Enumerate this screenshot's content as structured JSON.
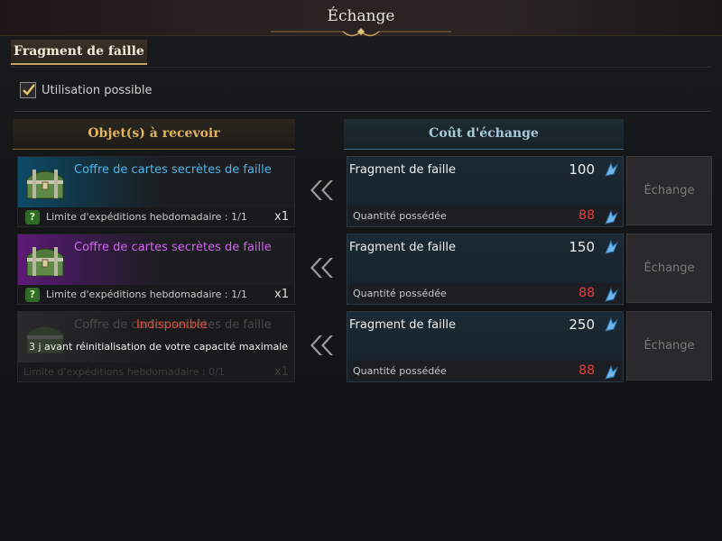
{
  "window": {
    "title": "Échange"
  },
  "tab": {
    "label": "Fragment de faille"
  },
  "filter": {
    "label": "Utilisation possible",
    "checked": true
  },
  "columns": {
    "receive": "Objet(s) à recevoir",
    "cost": "Coût d'échange"
  },
  "rows": [
    {
      "item_name": "Coffre de cartes secrètes de faille",
      "rarity_color": "#4db6e9",
      "limit": "Limite d'expéditions hebdomadaire : 1/1",
      "quantity": "x1",
      "cost_name": "Fragment de faille",
      "cost_value": "100",
      "owned_label": "Quantité possédée",
      "owned_value": "88",
      "button": "Échange"
    },
    {
      "item_name": "Coffre de cartes secrètes de faille",
      "rarity_color": "#d066f0",
      "limit": "Limite d'expéditions hebdomadaire : 1/1",
      "quantity": "x1",
      "cost_name": "Fragment de faille",
      "cost_value": "150",
      "owned_label": "Quantité possédée",
      "owned_value": "88",
      "button": "Échange"
    },
    {
      "item_name": "Coffre de cartes secrètes de faille",
      "unavailable": "Indisponible",
      "reset_note": "3 j avant réinitialisation de votre capacité maximale",
      "limit": "Limite d'expéditions hebdomadaire : 0/1",
      "quantity": "x1",
      "cost_name": "Fragment de faille",
      "cost_value": "250",
      "owned_label": "Quantité possédée",
      "owned_value": "88",
      "button": "Échange"
    }
  ],
  "icons": {
    "chest": "treasure-chest-icon",
    "crystal": "rift-fragment-icon",
    "arrows": "double-chevron-left-icon",
    "help": "question-icon",
    "check": "checkmark-icon"
  },
  "colors": {
    "accent_gold": "#e2b55c",
    "accent_blue": "#a9c9d8",
    "owned_red": "#ee3b3b",
    "unavailable_red": "#e04a3a"
  }
}
